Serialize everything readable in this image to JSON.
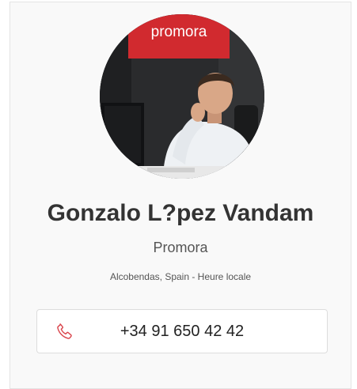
{
  "profile": {
    "name": "Gonzalo L?pez Vandam",
    "company": "Promora",
    "location": "Alcobendas, Spain - Heure locale",
    "photo_sign_text": "promora",
    "phone": "+34 91 650 42 42"
  },
  "icons": {
    "phone": "phone-icon"
  },
  "colors": {
    "brand_red": "#d12a2f",
    "phone_icon": "#d9434a",
    "name_text": "#333333"
  }
}
